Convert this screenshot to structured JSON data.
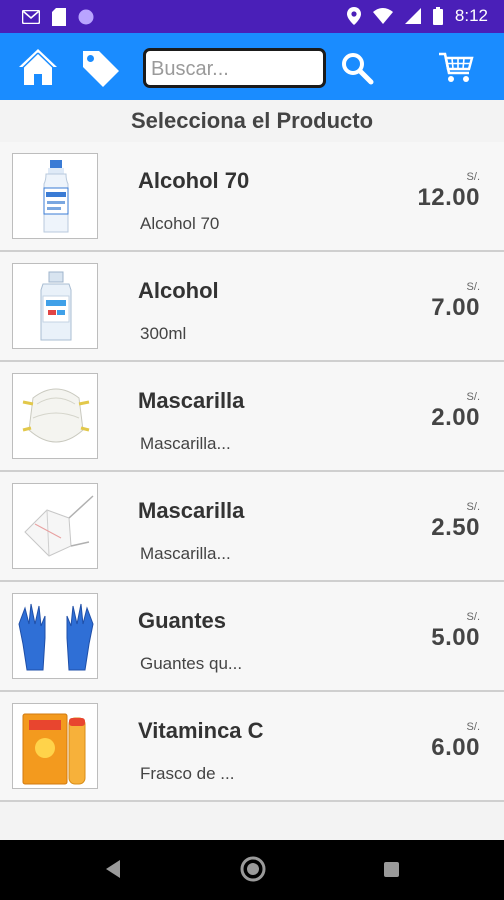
{
  "status_bar": {
    "time": "8:12",
    "icons_left": [
      "gmail-icon",
      "sim-card-icon",
      "circle-app-icon"
    ],
    "icons_right": [
      "location-icon",
      "wifi-icon",
      "signal-icon",
      "battery-icon"
    ]
  },
  "app_bar": {
    "search_placeholder": "Buscar...",
    "search_value": "",
    "icons": [
      "home-icon",
      "tag-icon",
      "search-icon",
      "cart-icon"
    ],
    "color": "#1a8cff"
  },
  "heading": "Selecciona el Producto",
  "products": [
    {
      "name": "Alcohol 70",
      "description": "Alcohol 70",
      "currency": "S/.",
      "price": "12.00",
      "image": "alcohol-bottle"
    },
    {
      "name": "Alcohol",
      "description": "300ml",
      "currency": "S/.",
      "price": "7.00",
      "image": "alcohol-gel-bottle"
    },
    {
      "name": "Mascarilla",
      "description": "Mascarilla...",
      "currency": "S/.",
      "price": "2.00",
      "image": "n95-mask"
    },
    {
      "name": "Mascarilla",
      "description": "Mascarilla...",
      "currency": "S/.",
      "price": "2.50",
      "image": "folded-mask"
    },
    {
      "name": "Guantes",
      "description": "Guantes qu...",
      "currency": "S/.",
      "price": "5.00",
      "image": "blue-gloves"
    },
    {
      "name": "Vitaminca C",
      "description": "Frasco de ...",
      "currency": "S/.",
      "price": "6.00",
      "image": "vitamin-c-tube"
    }
  ],
  "nav_bar": {
    "icons": [
      "back-icon",
      "home-circle-icon",
      "recents-icon"
    ]
  }
}
